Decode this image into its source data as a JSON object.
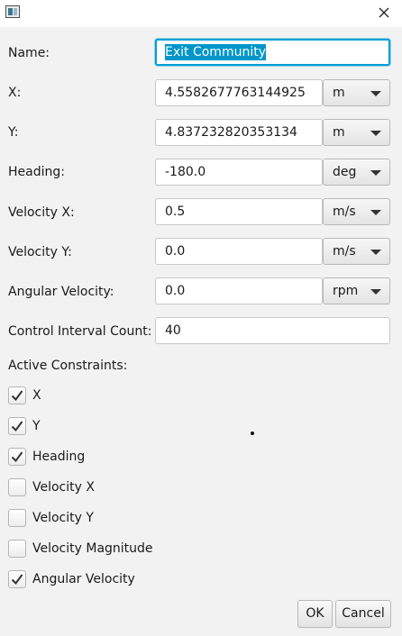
{
  "window": {
    "title": ""
  },
  "form": {
    "name_label": "Name:",
    "name_value": "Exit Community",
    "x_label": "X:",
    "x_value": "4.5582677763144925",
    "x_unit": "m",
    "y_label": "Y:",
    "y_value": "4.837232820353134",
    "y_unit": "m",
    "heading_label": "Heading:",
    "heading_value": "-180.0",
    "heading_unit": "deg",
    "vx_label": "Velocity X:",
    "vx_value": "0.5",
    "vx_unit": "m/s",
    "vy_label": "Velocity Y:",
    "vy_value": "0.0",
    "vy_unit": "m/s",
    "av_label": "Angular Velocity:",
    "av_value": "0.0",
    "av_unit": "rpm",
    "cic_label": "Control Interval Count:",
    "cic_value": "40"
  },
  "constraints": {
    "label": "Active Constraints:",
    "items": [
      {
        "label": "X",
        "checked": true
      },
      {
        "label": "Y",
        "checked": true
      },
      {
        "label": "Heading",
        "checked": true
      },
      {
        "label": "Velocity X",
        "checked": false
      },
      {
        "label": "Velocity Y",
        "checked": false
      },
      {
        "label": "Velocity Magnitude",
        "checked": false
      },
      {
        "label": "Angular Velocity",
        "checked": true
      }
    ]
  },
  "buttons": {
    "ok": "OK",
    "cancel": "Cancel"
  },
  "icons": {
    "app": "app-window-icon",
    "close": "close-icon",
    "dropdown": "chevron-down-icon",
    "check": "checkmark-icon"
  }
}
